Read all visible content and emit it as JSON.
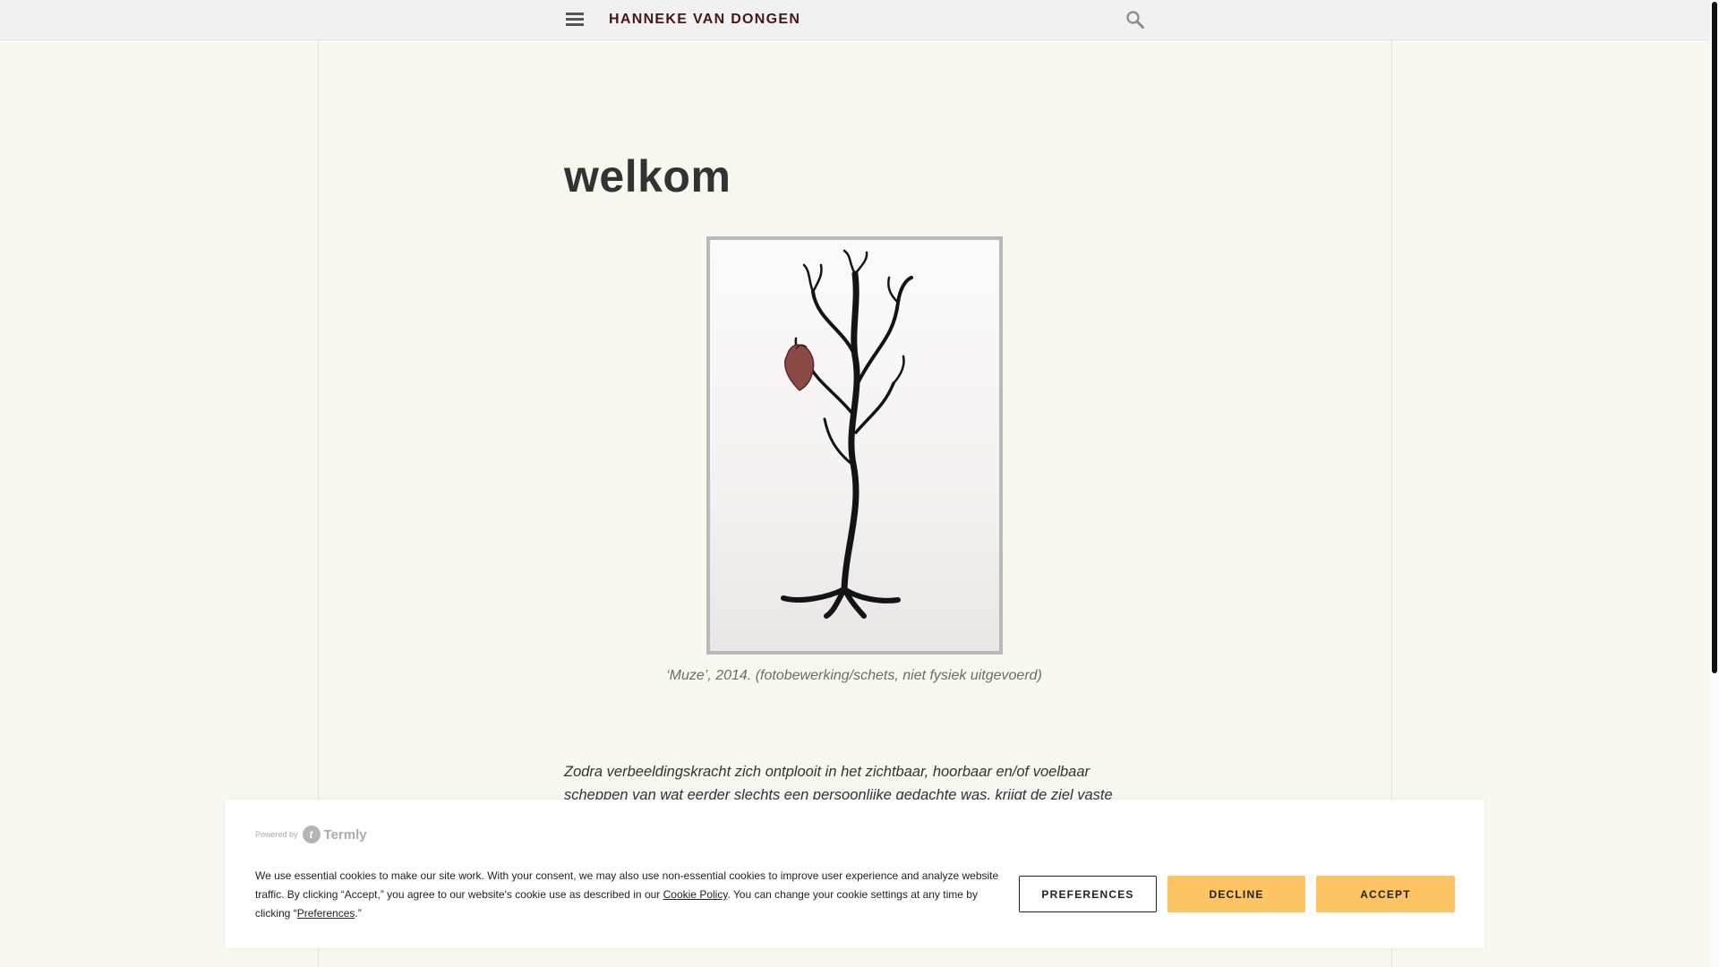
{
  "header": {
    "site_title": "HANNEKE VAN DONGEN",
    "menu_icon": "hamburger-menu-icon",
    "search_icon": "search-icon"
  },
  "main": {
    "heading": "welkom",
    "artwork": {
      "description_icon": "artwork-image",
      "caption": "‘Muze’, 2014. (fotobewerking/schets, niet fysiek uitgevoerd)"
    },
    "paragraph": "Zodra verbeeldingskracht zich ontplooit in het zichtbaar, hoorbaar en/of voelbaar scheppen van wat eerder slechts een persoonlijke gedachte was, krijgt de ziel vaste grond onder de"
  },
  "cookie_banner": {
    "powered_by": "Powered by",
    "brand": "Termly",
    "text_before_policy": "We use essential cookies to make our site work. With your consent, we may also use non-essential cookies to improve user experience and analyze website traffic. By clicking “Accept,” you agree to our website's cookie use as described in our ",
    "policy_link": "Cookie Policy",
    "text_after_policy": ". You can change your cookie settings at any time by clicking “",
    "preferences_link": "Preferences",
    "text_end": ".”",
    "buttons": {
      "preferences": "PREFERENCES",
      "decline": "DECLINE",
      "accept": "ACCEPT"
    }
  },
  "colors": {
    "background": "#f8f7f0",
    "title": "#4a1515",
    "button_accent": "#fcc462"
  }
}
